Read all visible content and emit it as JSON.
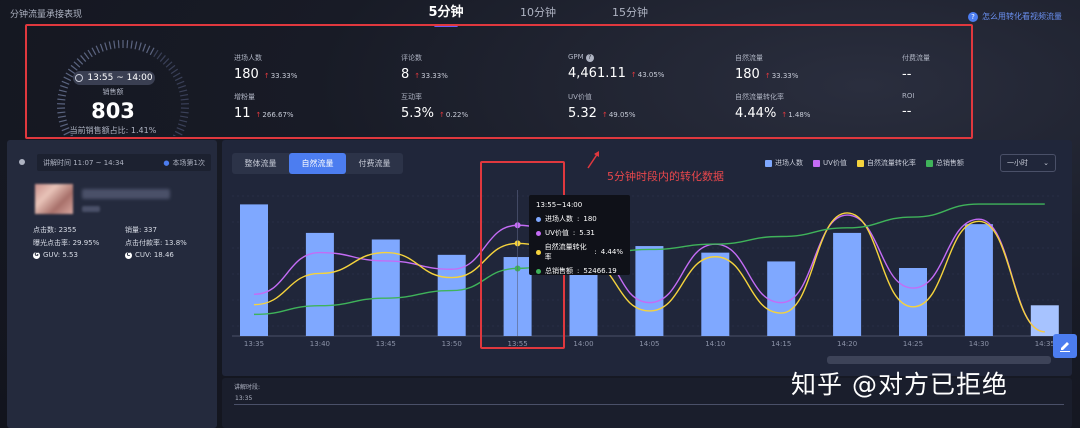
{
  "header": {
    "page_title": "分钟流量承接表现",
    "time_tabs": [
      "5分钟",
      "10分钟",
      "15分钟"
    ],
    "help_link": "怎么用转化看视频流量"
  },
  "gauge": {
    "time_range": "13:55 ~ 14:00",
    "label": "销售额",
    "value": "803",
    "ratio": "当前销售额占比: 1.41%"
  },
  "metrics": [
    {
      "label": "进场人数",
      "value": "180",
      "change": "33.33%",
      "hint": false
    },
    {
      "label": "评论数",
      "value": "8",
      "change": "33.33%",
      "hint": false
    },
    {
      "label": "GPM",
      "value": "4,461.11",
      "change": "43.05%",
      "hint": true
    },
    {
      "label": "自然流量",
      "value": "180",
      "change": "33.33%",
      "hint": false
    },
    {
      "label": "付费流量",
      "value": "--",
      "change": "",
      "hint": false
    },
    {
      "label": "增粉量",
      "value": "11",
      "change": "266.67%",
      "hint": false
    },
    {
      "label": "互动率",
      "value": "5.3%",
      "change": "0.22%",
      "hint": false
    },
    {
      "label": "UV价值",
      "value": "5.32",
      "change": "49.05%",
      "hint": false
    },
    {
      "label": "自然流量转化率",
      "value": "4.44%",
      "change": "1.48%",
      "hint": false
    },
    {
      "label": "ROI",
      "value": "--",
      "change": "",
      "hint": false
    }
  ],
  "left_panel": {
    "time_label": "讲解时间 11:07 ~ 14:34",
    "session_label": "本场第1次",
    "stats": [
      {
        "label": "点击数: 2355"
      },
      {
        "label": "销量: 337"
      },
      {
        "label": "曝光点击率: 29.95%"
      },
      {
        "label": "点击付款率: 13.8%"
      },
      {
        "label": "GUV: 5.53"
      },
      {
        "label": "CUV: 18.46"
      }
    ]
  },
  "main": {
    "subtabs": [
      "整体流量",
      "自然流量",
      "付费流量"
    ],
    "active_subtab": 1,
    "legend": [
      {
        "name": "进场人数",
        "color": "#7fa8ff"
      },
      {
        "name": "UV价值",
        "color": "#c46cf5"
      },
      {
        "name": "自然流量转化率",
        "color": "#f5d33d"
      },
      {
        "name": "总销售额",
        "color": "#3fb35a"
      }
    ],
    "dropdown": "一小时"
  },
  "chart_data": {
    "type": "bar",
    "x": [
      "13:35",
      "13:40",
      "13:45",
      "13:50",
      "13:55",
      "14:00",
      "14:05",
      "14:10",
      "14:15",
      "14:20",
      "14:25",
      "14:30",
      "14:35"
    ],
    "series": [
      {
        "name": "进场人数",
        "type": "bar",
        "color": "#7fa8ff",
        "values": [
          300,
          235,
          220,
          185,
          180,
          165,
          205,
          190,
          170,
          235,
          155,
          255,
          70
        ]
      },
      {
        "name": "UV价值",
        "type": "line",
        "color": "#c46cf5",
        "values": [
          2.0,
          4.0,
          3.6,
          3.2,
          5.31,
          4.6,
          1.6,
          4.4,
          1.6,
          5.8,
          2.3,
          5.6,
          0.2
        ]
      },
      {
        "name": "自然流量转化率",
        "type": "line",
        "color": "#f5d33d",
        "values": [
          1.5,
          3.0,
          4.0,
          2.8,
          4.44,
          3.7,
          1.2,
          3.8,
          1.1,
          5.9,
          1.4,
          5.5,
          0.2
        ]
      },
      {
        "name": "总销售额",
        "type": "line",
        "color": "#3fb35a",
        "values": [
          10000,
          18000,
          25000,
          32000,
          52466.19,
          64000,
          70000,
          75000,
          82000,
          90000,
          100000,
          112000,
          112000
        ]
      }
    ],
    "tooltip": {
      "title": "13:55~14:00",
      "rows": [
        {
          "name": "进场人数",
          "value": "180",
          "color": "#7fa8ff"
        },
        {
          "name": "UV价值",
          "value": "5.31",
          "color": "#c46cf5"
        },
        {
          "name": "自然流量转化率",
          "value": "4.44%",
          "color": "#f5d33d"
        },
        {
          "name": "总销售额",
          "value": "52466.19",
          "color": "#3fb35a"
        }
      ]
    }
  },
  "annotation": {
    "text": "5分钟时段内的转化数据"
  },
  "bottom": {
    "label": "讲解时段:",
    "time": "13:35"
  },
  "watermark": "知乎 @对方已拒绝"
}
